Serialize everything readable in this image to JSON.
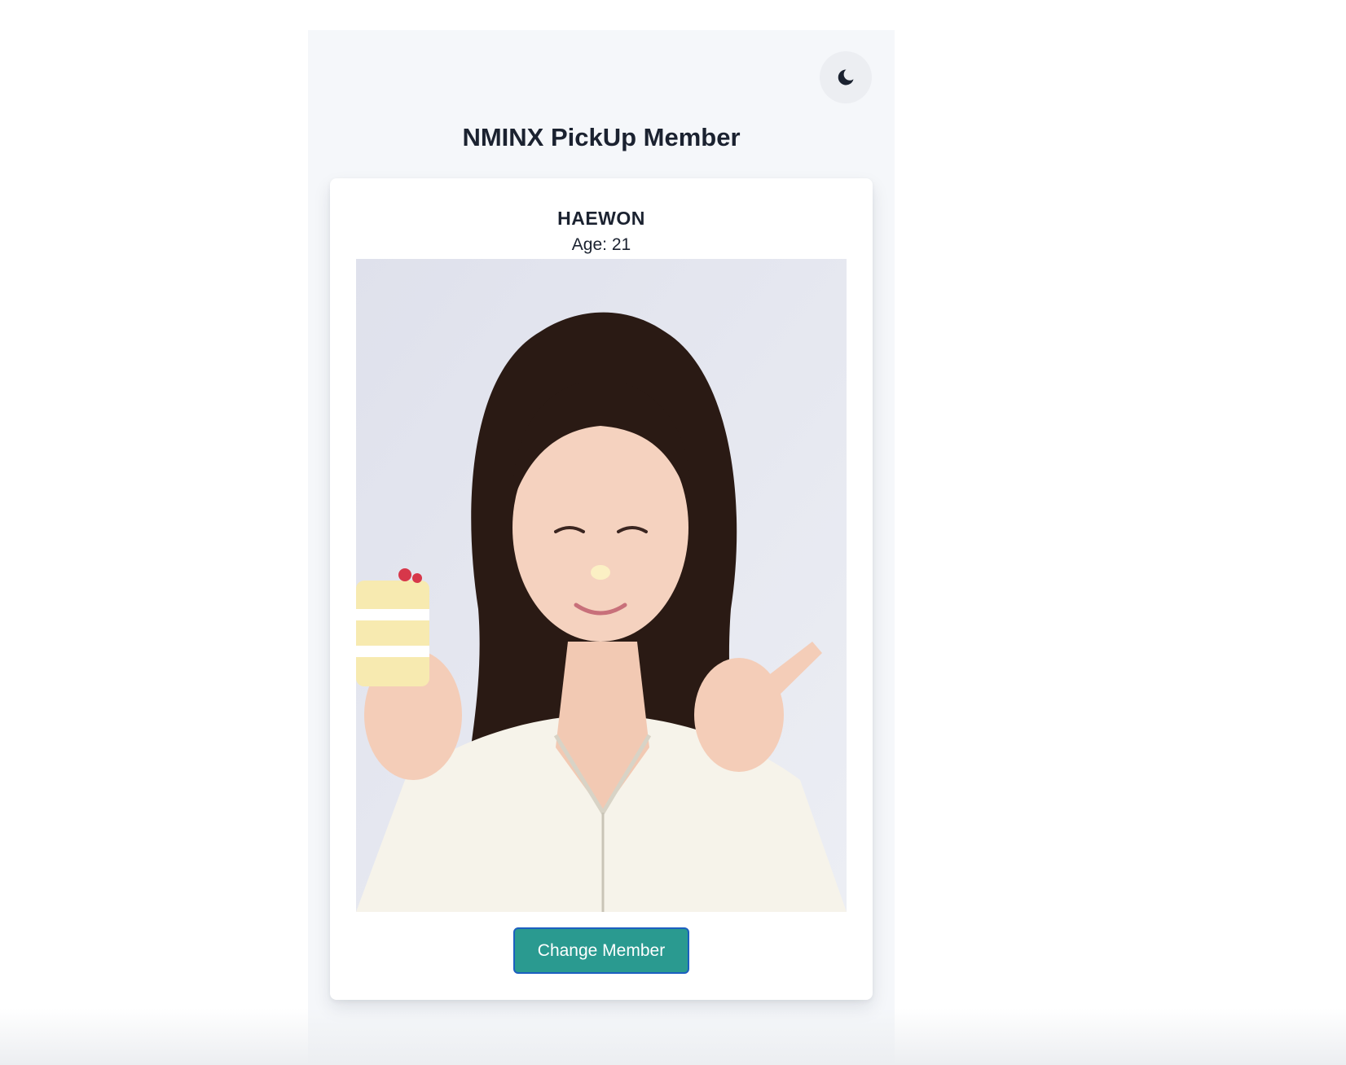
{
  "header": {
    "title": "NMINX PickUp Member",
    "theme_toggle_icon": "moon-icon"
  },
  "member": {
    "name": "HAEWON",
    "age_label": "Age: 21",
    "photo_icon": "member-photo"
  },
  "actions": {
    "change_label": "Change Member"
  },
  "colors": {
    "page_background": "#f5f7fa",
    "button": "#2a9a90",
    "button_border": "#1c5fc0",
    "text": "#1b2230"
  }
}
